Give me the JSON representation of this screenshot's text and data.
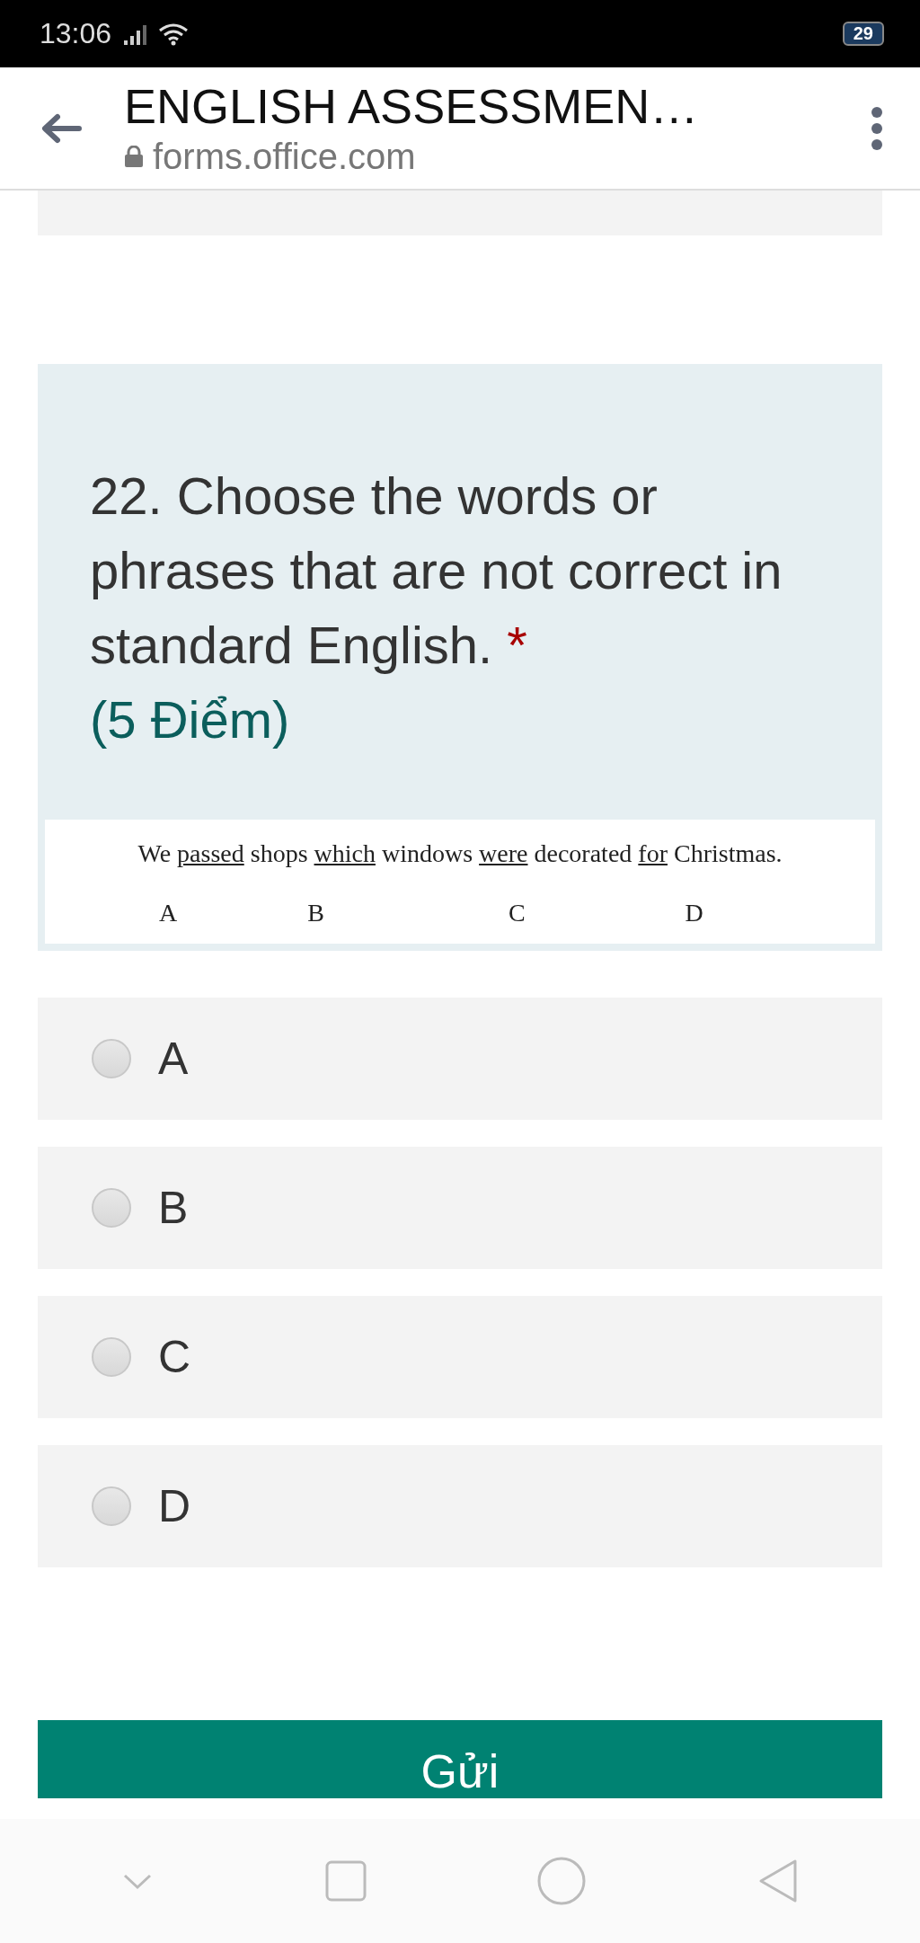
{
  "status_bar": {
    "time": "13:06",
    "battery": "29"
  },
  "header": {
    "title": "ENGLISH ASSESSMEN…",
    "url": "forms.office.com"
  },
  "question": {
    "number": "22.",
    "text": "Choose the words or phrases that are not correct in standard English.",
    "required_mark": "*",
    "points": "(5 Điểm)",
    "sentence": [
      {
        "text": "We ",
        "underlined": false
      },
      {
        "text": "passed",
        "underlined": true
      },
      {
        "text": " shops ",
        "underlined": false
      },
      {
        "text": "which",
        "underlined": true
      },
      {
        "text": " windows ",
        "underlined": false
      },
      {
        "text": "were",
        "underlined": true
      },
      {
        "text": " decorated ",
        "underlined": false
      },
      {
        "text": "for",
        "underlined": true
      },
      {
        "text": " Christmas.",
        "underlined": false
      }
    ],
    "sentence_labels": [
      "A",
      "B",
      "C",
      "D"
    ],
    "options": [
      {
        "label": "A",
        "selected": false
      },
      {
        "label": "B",
        "selected": false
      },
      {
        "label": "C",
        "selected": false
      },
      {
        "label": "D",
        "selected": false
      }
    ]
  },
  "submit_button": "Gửi"
}
